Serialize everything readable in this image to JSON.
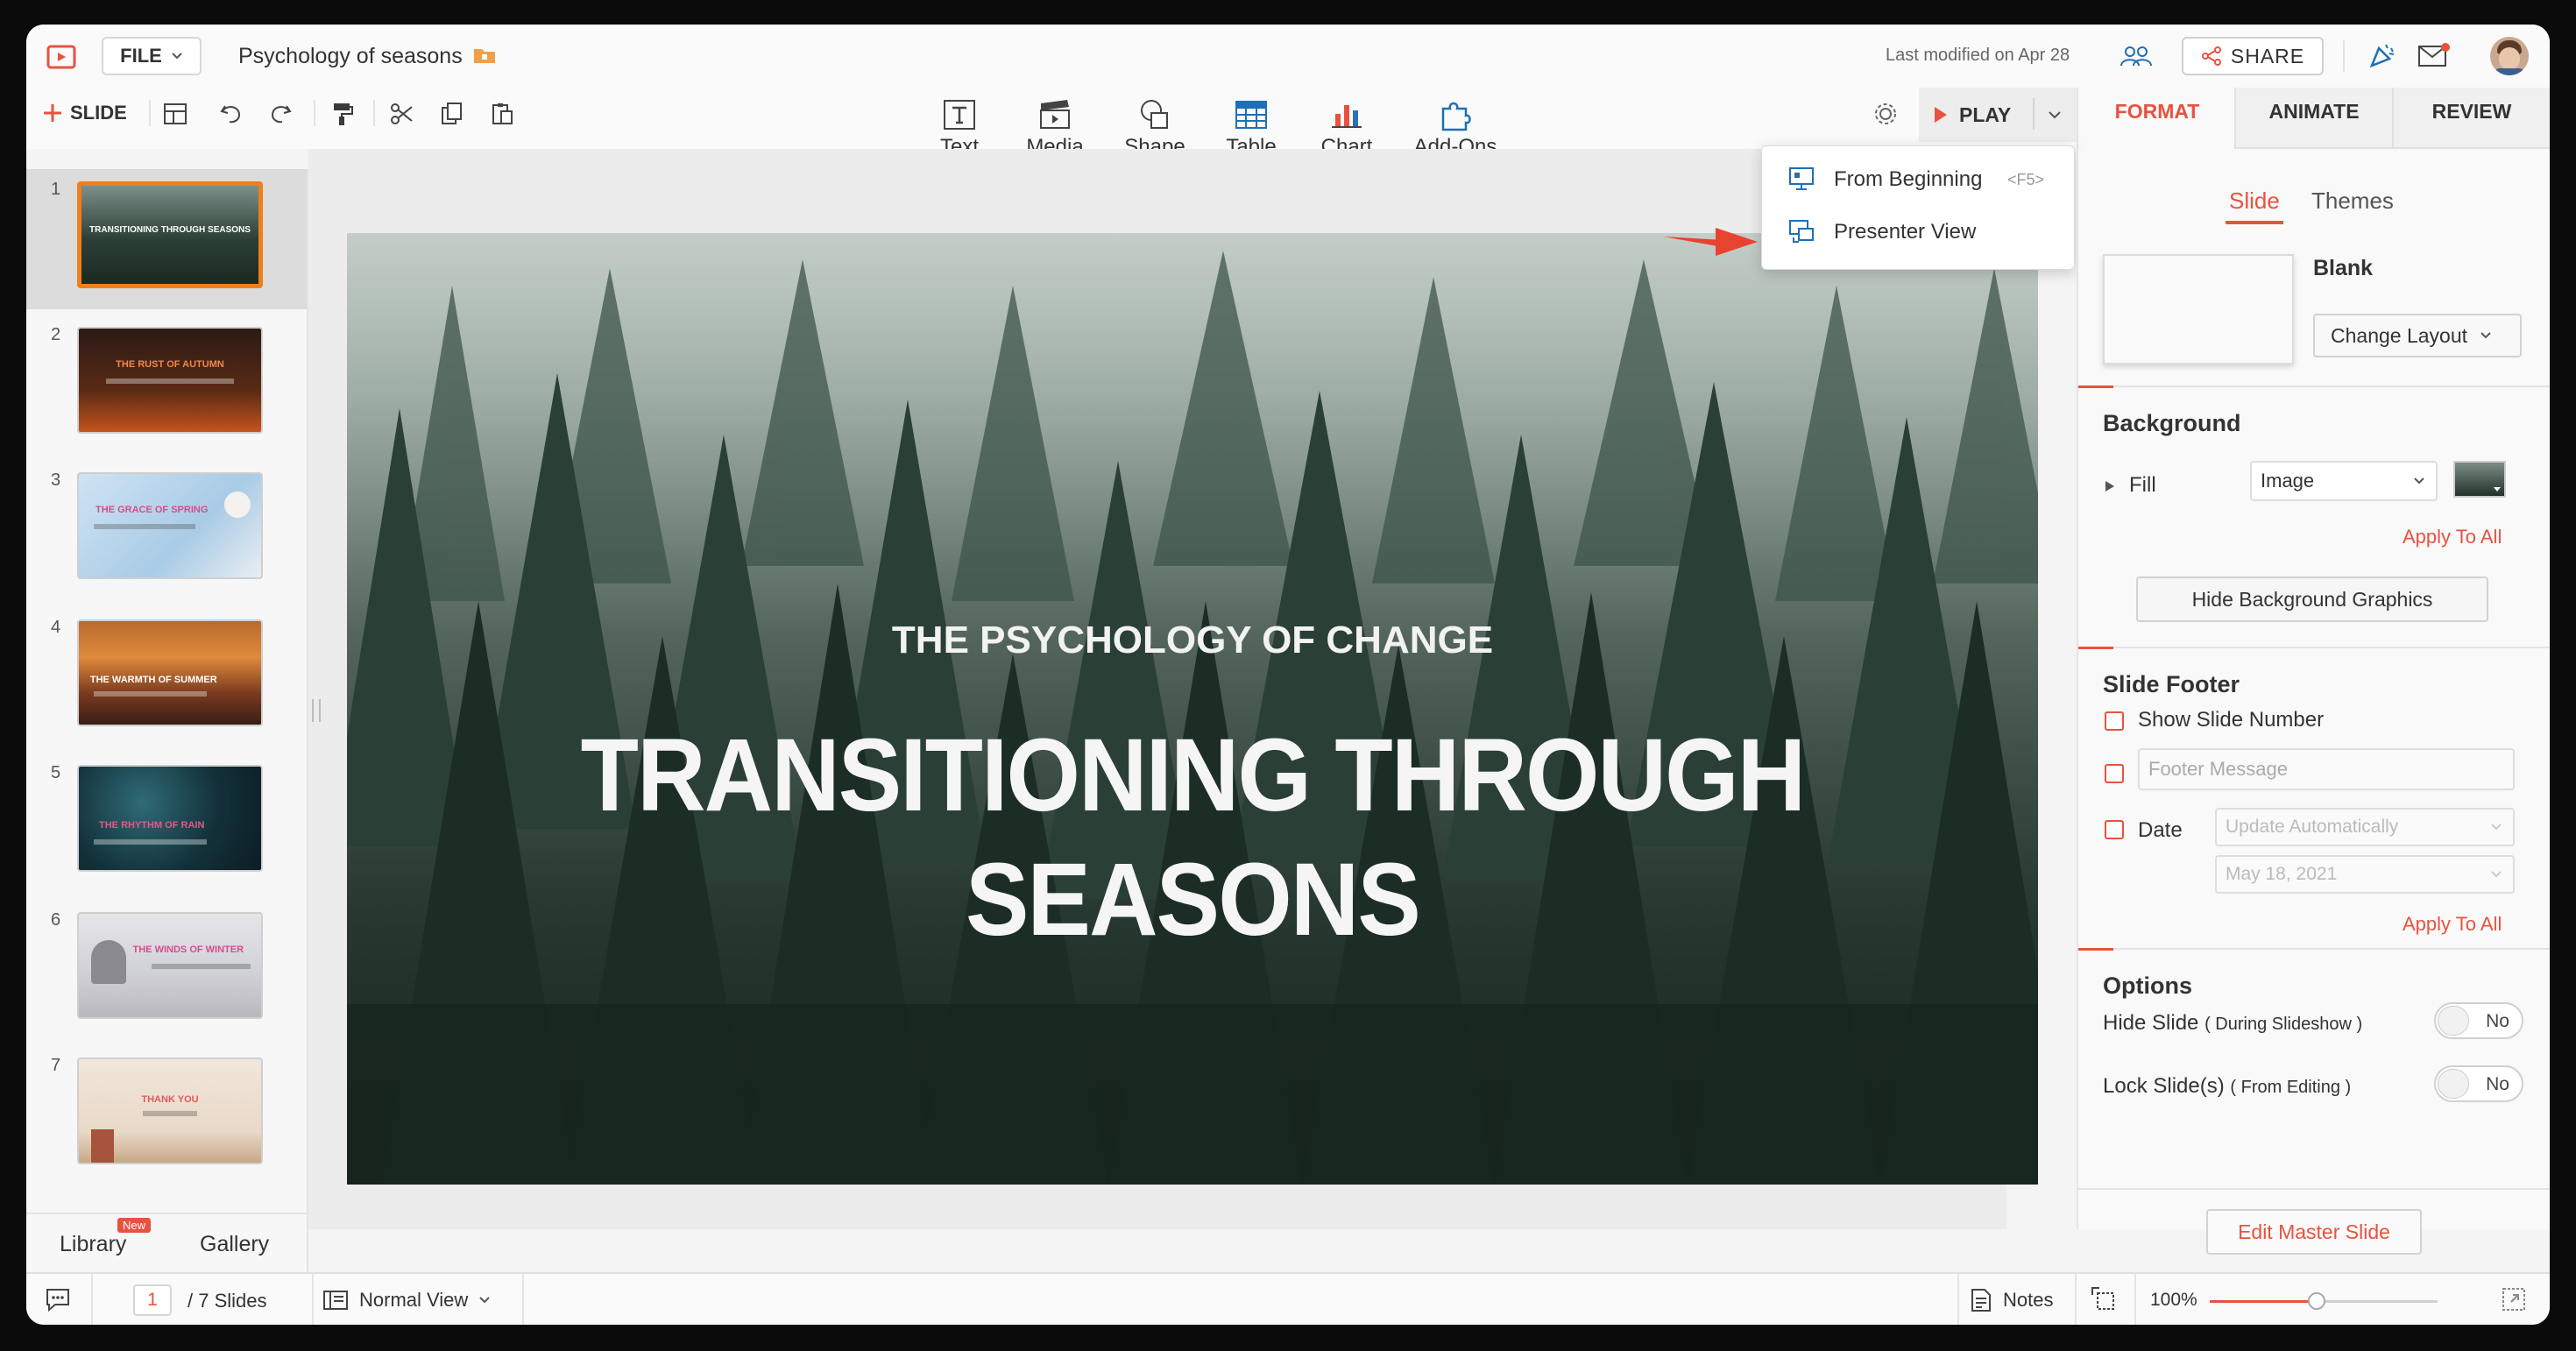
{
  "window": {
    "title": "Psychology of seasons"
  },
  "header": {
    "file_label": "FILE",
    "doc_title": "Psychology of seasons",
    "last_modified": "Last modified on Apr 28",
    "share_label": "SHARE",
    "slide_label": "SLIDE",
    "play_label": "PLAY"
  },
  "insert_tools": [
    {
      "label": "Text",
      "icon": "text-box-icon"
    },
    {
      "label": "Media",
      "icon": "media-clapper-icon"
    },
    {
      "label": "Shape",
      "icon": "shape-icon"
    },
    {
      "label": "Table",
      "icon": "table-icon"
    },
    {
      "label": "Chart",
      "icon": "bar-chart-icon"
    },
    {
      "label": "Add-Ons",
      "icon": "puzzle-icon"
    }
  ],
  "right_tabs": [
    "FORMAT",
    "ANIMATE",
    "REVIEW"
  ],
  "play_menu": {
    "items": [
      {
        "label": "From Beginning",
        "shortcut": "<F5>"
      },
      {
        "label": "Presenter View",
        "shortcut": ""
      }
    ]
  },
  "slides": [
    {
      "num": "1",
      "title": "TRANSITIONING THROUGH SEASONS"
    },
    {
      "num": "2",
      "title": "THE RUST OF AUTUMN"
    },
    {
      "num": "3",
      "title": "THE GRACE OF SPRING"
    },
    {
      "num": "4",
      "title": "THE WARMTH OF SUMMER"
    },
    {
      "num": "5",
      "title": "THE RHYTHM OF RAIN"
    },
    {
      "num": "6",
      "title": "THE WINDS OF WINTER"
    },
    {
      "num": "7",
      "title": "THANK YOU"
    }
  ],
  "left_footer": {
    "library": "Library",
    "library_badge": "New",
    "gallery": "Gallery"
  },
  "slide_content": {
    "kicker": "THE PSYCHOLOGY OF CHANGE",
    "title_line1": "TRANSITIONING THROUGH",
    "title_line2": "SEASONS"
  },
  "format_panel": {
    "subtabs": [
      "Slide",
      "Themes"
    ],
    "layout_name": "Blank",
    "change_layout": "Change Layout",
    "background": {
      "title": "Background",
      "fill_label": "Fill",
      "fill_value": "Image",
      "apply_all": "Apply To All",
      "hide_bg_graphics": "Hide Background Graphics"
    },
    "footer": {
      "title": "Slide Footer",
      "show_slide_number": "Show Slide Number",
      "footer_placeholder": "Footer Message",
      "date_label": "Date",
      "date_mode": "Update Automatically",
      "date_value": "May 18, 2021",
      "apply_all": "Apply To All"
    },
    "options": {
      "title": "Options",
      "hide_slide": "Hide Slide",
      "hide_slide_note": "( During Slideshow )",
      "hide_value": "No",
      "lock_slide": "Lock Slide(s)",
      "lock_slide_note": "( From Editing )",
      "lock_value": "No"
    },
    "edit_master": "Edit Master Slide"
  },
  "status": {
    "page_current": "1",
    "page_total": "/ 7 Slides",
    "view_mode": "Normal View",
    "notes": "Notes",
    "zoom": "100%",
    "zoom_level": 0.47
  },
  "colors": {
    "accent": "#e8523f",
    "selection": "#f07e1b",
    "arrow": "#e8432f"
  }
}
